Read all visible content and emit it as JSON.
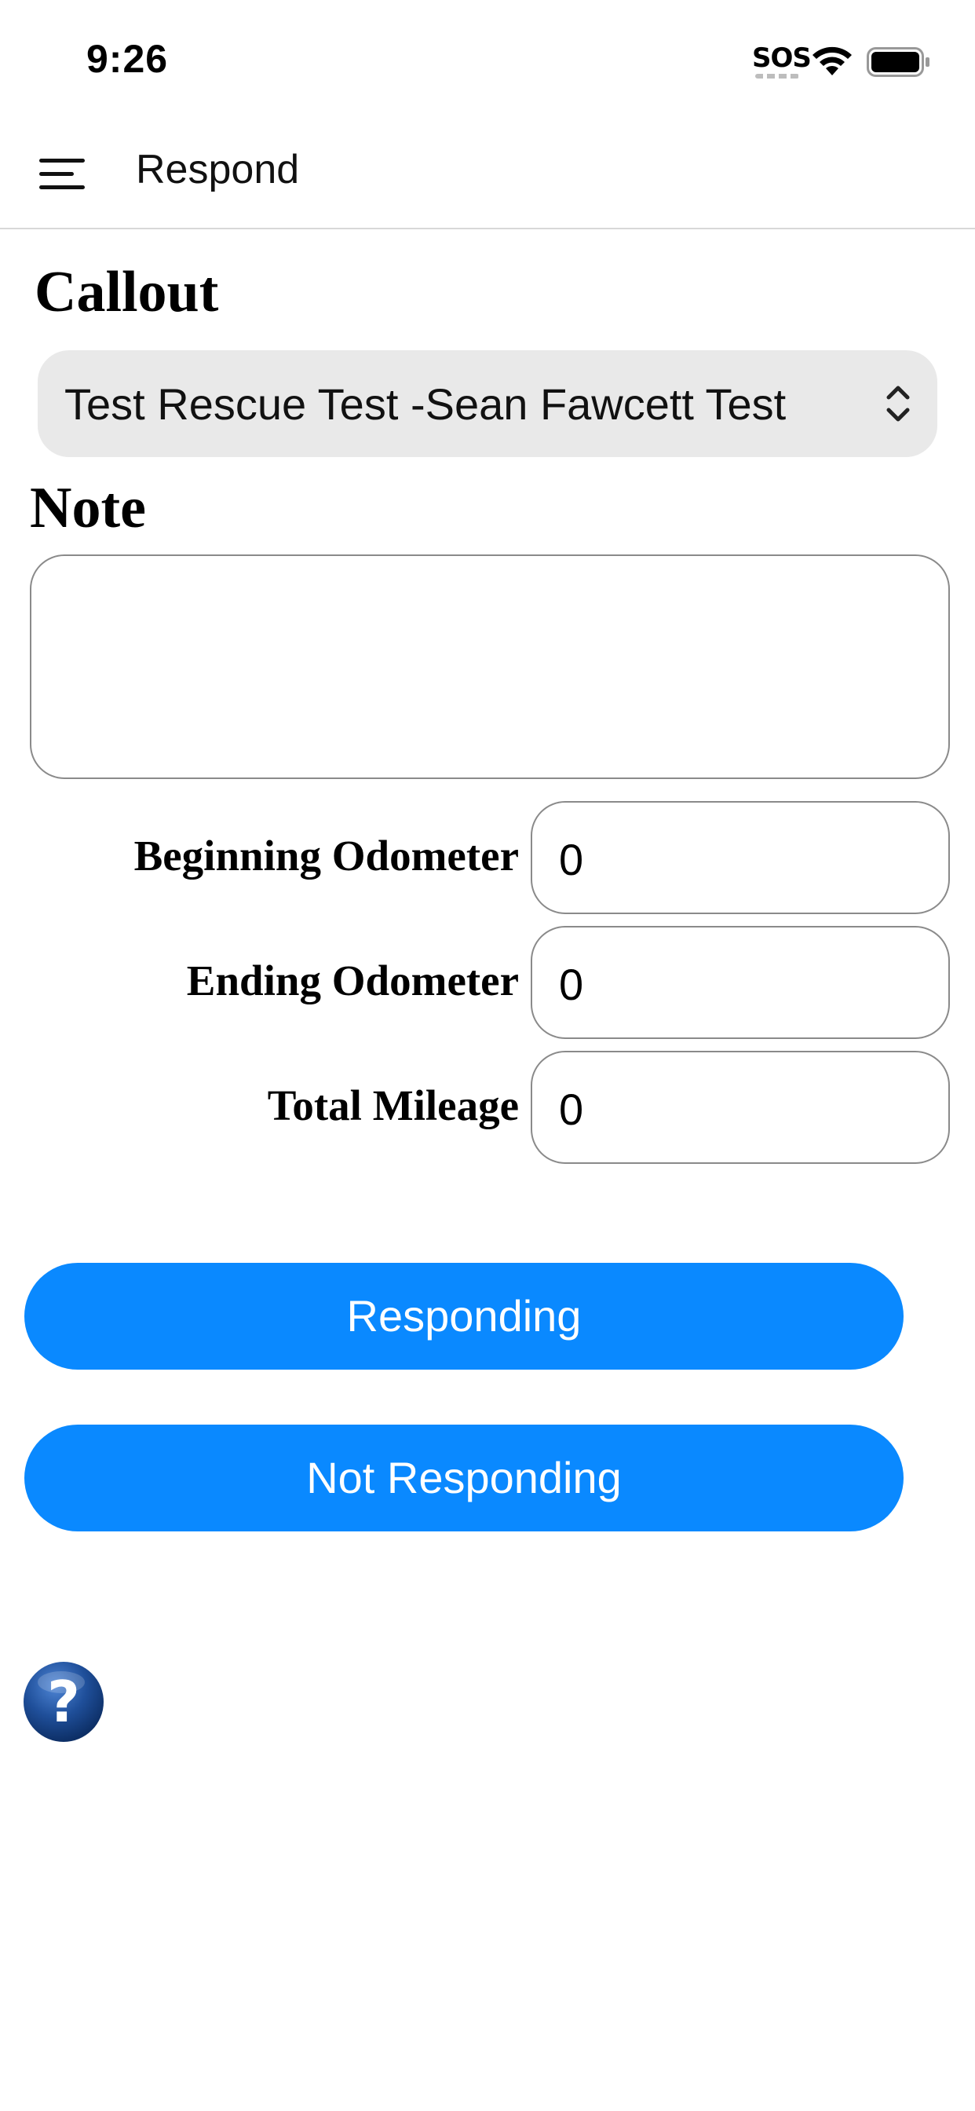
{
  "status_bar": {
    "time": "9:26",
    "sos": "SOS"
  },
  "header": {
    "menu_icon": "hamburger-menu-icon",
    "title": "Respond"
  },
  "callout": {
    "label": "Callout",
    "selected": "Test Rescue Test -Sean Fawcett Test",
    "chevron_icon": "chevron-up-down-icon"
  },
  "note": {
    "label": "Note",
    "value": ""
  },
  "odometer": {
    "beginning_label": "Beginning Odometer",
    "beginning_value": "0",
    "ending_label": "Ending Odometer",
    "ending_value": "0",
    "total_label": "Total Mileage",
    "total_value": "0"
  },
  "buttons": {
    "responding": "Responding",
    "not_responding": "Not Responding"
  },
  "help": {
    "icon": "question-mark-icon",
    "glyph": "?"
  },
  "colors": {
    "button_blue": "#0a89ff",
    "select_bg": "#e9e9e9",
    "help_blue": "#1f4f9a"
  }
}
